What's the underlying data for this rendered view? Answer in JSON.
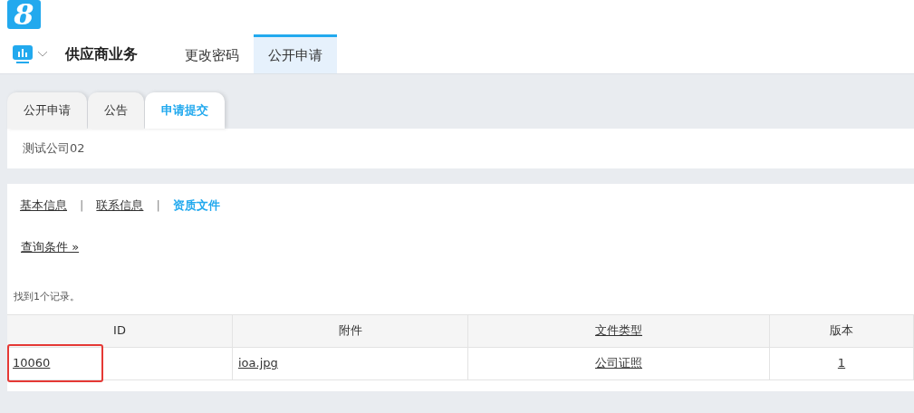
{
  "logo": "8",
  "nav": {
    "title": "供应商业务",
    "items": [
      {
        "label": "更改密码",
        "selected": false
      },
      {
        "label": "公开申请",
        "selected": true
      }
    ]
  },
  "tabs": [
    {
      "label": "公开申请",
      "selected": false
    },
    {
      "label": "公告",
      "selected": false
    },
    {
      "label": "申请提交",
      "selected": true
    }
  ],
  "company": "测试公司02",
  "sections": [
    {
      "label": "基本信息",
      "selected": false
    },
    {
      "label": "联系信息",
      "selected": false
    },
    {
      "label": "资质文件",
      "selected": true
    }
  ],
  "section_separator": "|",
  "query_link": "查询条件 »",
  "result_count": "找到1个记录。",
  "table": {
    "columns": [
      {
        "label": "ID",
        "sortable": false
      },
      {
        "label": "附件",
        "sortable": false
      },
      {
        "label": "文件类型",
        "sortable": true
      },
      {
        "label": "版本",
        "sortable": false
      }
    ],
    "rows": [
      {
        "cells": [
          {
            "text": "10060",
            "highlighted": true
          },
          {
            "text": "ioa.jpg",
            "highlighted": false
          },
          {
            "text": "公司证照",
            "highlighted": false
          },
          {
            "text": "1",
            "highlighted": false
          }
        ]
      }
    ]
  }
}
